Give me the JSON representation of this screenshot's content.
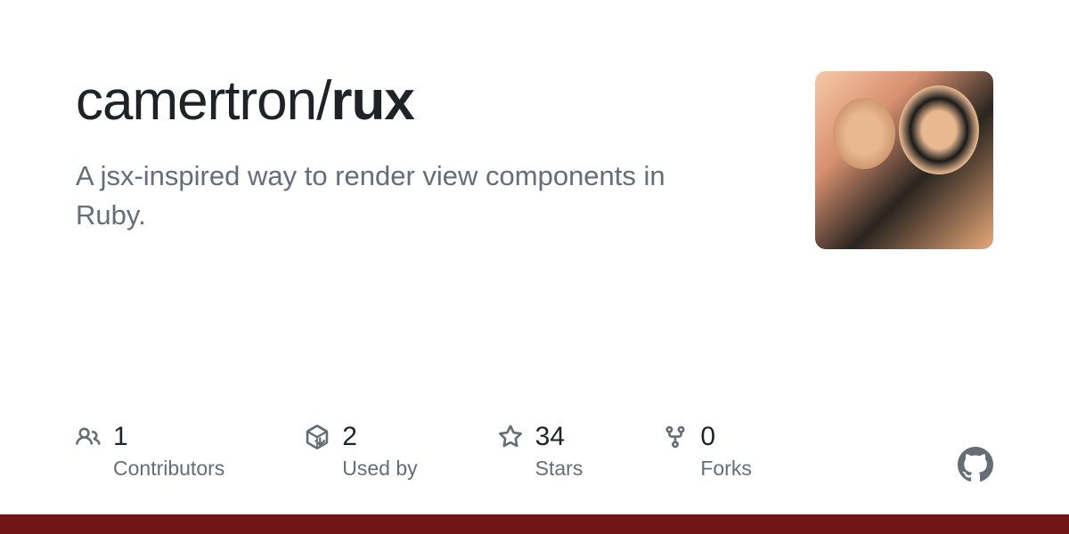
{
  "repo": {
    "owner": "camertron",
    "name": "rux",
    "description": "A jsx-inspired way to render view components in Ruby."
  },
  "stats": {
    "contributors": {
      "value": "1",
      "label": "Contributors"
    },
    "usedby": {
      "value": "2",
      "label": "Used by"
    },
    "stars": {
      "value": "34",
      "label": "Stars"
    },
    "forks": {
      "value": "0",
      "label": "Forks"
    }
  },
  "colors": {
    "bottomBar": "#701516"
  }
}
